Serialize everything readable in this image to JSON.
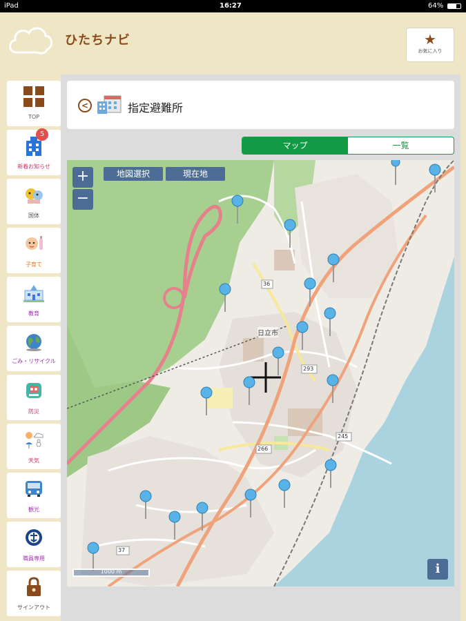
{
  "status": {
    "device": "iPad",
    "time": "16:27",
    "battery": "64%"
  },
  "app": {
    "title": "ひたちナビ",
    "favorite_label": "お気に入り"
  },
  "sidebar": {
    "items": [
      {
        "label": "TOP",
        "icon": "grid-icon"
      },
      {
        "label": "新着お知らせ",
        "icon": "building-icon",
        "badge": "5"
      },
      {
        "label": "国体",
        "icon": "mascot-icon"
      },
      {
        "label": "子育て",
        "icon": "baby-icon"
      },
      {
        "label": "教育",
        "icon": "school-icon"
      },
      {
        "label": "ごみ・リサイクル",
        "icon": "globe-icon"
      },
      {
        "label": "防災",
        "icon": "shield-icon"
      },
      {
        "label": "天気",
        "icon": "weather-icon"
      },
      {
        "label": "観光",
        "icon": "bus-icon"
      },
      {
        "label": "職員専用",
        "icon": "emblem-icon"
      },
      {
        "label": "サインアウト",
        "icon": "lock-icon"
      }
    ]
  },
  "page": {
    "title": "指定避難所",
    "back_icon": "chevron-left-icon",
    "title_icon": "shelter-building-icon"
  },
  "view_toggle": {
    "map_label": "マップ",
    "list_label": "一覧",
    "selected": "map"
  },
  "map": {
    "zoom_in": "+",
    "zoom_out": "−",
    "select_area_label": "地図選択",
    "current_location_label": "現在地",
    "info_label": "i",
    "scale_label": "1000 m",
    "city_label": "日立市",
    "road_labels": [
      "36",
      "293",
      "266",
      "245",
      "37"
    ],
    "colors": {
      "accent_green": "#129a44",
      "brand_brown": "#8b4a1c",
      "map_button": "#4c6b95",
      "sea": "#aad3df",
      "forest": "#8dbe7b",
      "pin": "#5ab3e6"
    }
  }
}
